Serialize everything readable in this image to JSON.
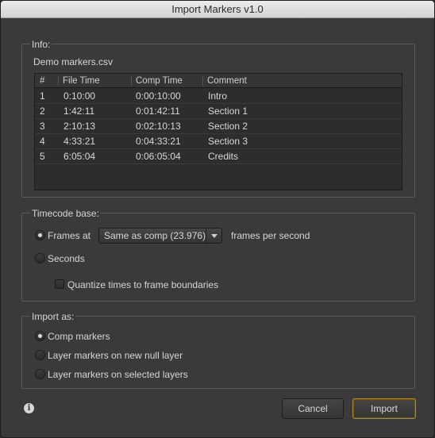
{
  "window": {
    "title": "Import Markers v1.0"
  },
  "info": {
    "section_title": "Info:",
    "file_name": "Demo markers.csv",
    "columns": [
      "#",
      "File Time",
      "Comp Time",
      "Comment"
    ],
    "rows": [
      [
        "1",
        "0:10:00",
        "0:00:10:00",
        "Intro"
      ],
      [
        "2",
        "1:42:11",
        "0:01:42:11",
        "Section 1"
      ],
      [
        "3",
        "2:10:13",
        "0:02:10:13",
        "Section 2"
      ],
      [
        "4",
        "4:33:21",
        "0:04:33:21",
        "Section 3"
      ],
      [
        "5",
        "6:05:04",
        "0:06:05:04",
        "Credits"
      ]
    ]
  },
  "timecode": {
    "section_title": "Timecode base:",
    "frames_at_label": "Frames at",
    "frames_at_selected": true,
    "fps_select_value": "Same as comp (23.976)",
    "fps_suffix": "frames per second",
    "seconds_label": "Seconds",
    "seconds_selected": false,
    "quantize_label": "Quantize times to frame boundaries",
    "quantize_checked": false
  },
  "import_as": {
    "section_title": "Import as:",
    "options": [
      {
        "label": "Comp markers",
        "selected": true
      },
      {
        "label": "Layer markers on new null layer",
        "selected": false
      },
      {
        "label": "Layer markers on selected layers",
        "selected": false
      }
    ]
  },
  "footer": {
    "info_icon": "info-icon",
    "cancel_label": "Cancel",
    "import_label": "Import"
  },
  "colors": {
    "dialog_bg": "#3a3a3a",
    "default_button_border": "#b58a22"
  }
}
